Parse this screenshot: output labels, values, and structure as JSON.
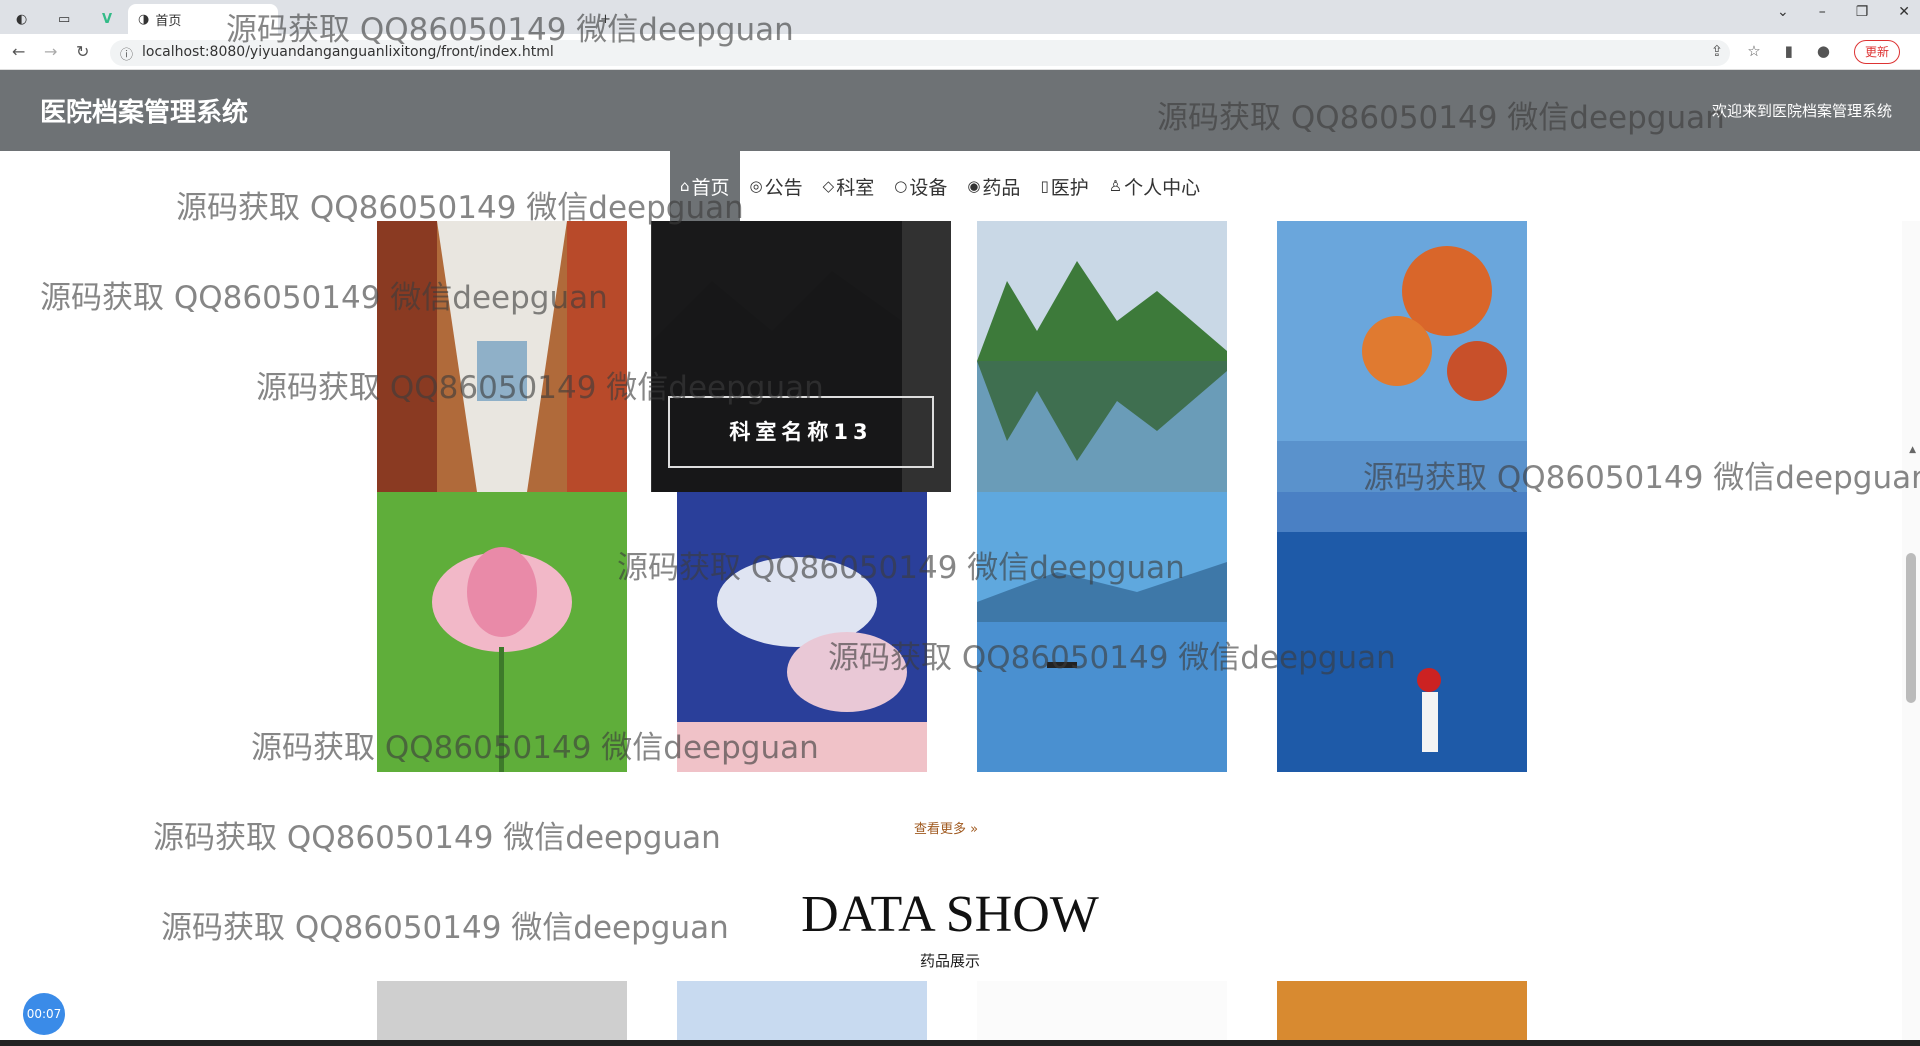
{
  "browser": {
    "tabs": [
      {
        "label": "首页",
        "active": true
      },
      {
        "label": "",
        "active": false
      }
    ],
    "url": "localhost:8080/yiyuandanganguanlixitong/front/index.html",
    "update_label": "更新"
  },
  "header": {
    "title": "医院档案管理系统",
    "welcome": "欢迎来到医院档案管理系统"
  },
  "menu": [
    {
      "icon": "home-icon",
      "glyph": "⌂",
      "label": "首页",
      "active": true
    },
    {
      "icon": "announce-icon",
      "glyph": "◎",
      "label": "公告",
      "active": false
    },
    {
      "icon": "tag-icon",
      "glyph": "◇",
      "label": "科室",
      "active": false
    },
    {
      "icon": "device-icon",
      "glyph": "○",
      "label": "设备",
      "active": false
    },
    {
      "icon": "medicine-icon",
      "glyph": "◉",
      "label": "药品",
      "active": false
    },
    {
      "icon": "care-icon",
      "glyph": "▯",
      "label": "医护",
      "active": false
    },
    {
      "icon": "user-icon",
      "glyph": "♙",
      "label": "个人中心",
      "active": false
    }
  ],
  "grid": {
    "hover_label": "科室名称13",
    "more_label": "查看更多 »"
  },
  "section": {
    "title": "DATA SHOW",
    "subtitle": "药品展示"
  },
  "timer": "00:07",
  "watermark": "源码获取 QQ86050149 微信deepguan",
  "colors": {
    "header_bg": "#6e7275",
    "accent": "#3a8be8"
  }
}
